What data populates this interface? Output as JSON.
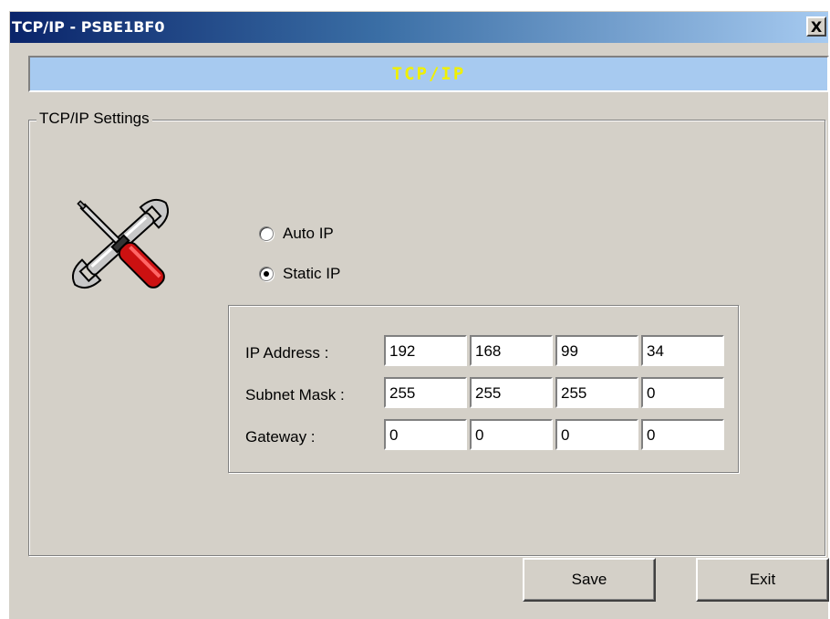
{
  "window": {
    "title": "TCP/IP - PSBE1BF0",
    "close_label": "X"
  },
  "banner": {
    "title": "TCP/IP"
  },
  "group": {
    "legend": "TCP/IP Settings"
  },
  "mode": {
    "options": [
      {
        "label": "Auto IP",
        "checked": false
      },
      {
        "label": "Static IP",
        "checked": true
      }
    ]
  },
  "network": {
    "rows": [
      {
        "label": "IP Address :",
        "octets": [
          "192",
          "168",
          "99",
          "34"
        ]
      },
      {
        "label": "Subnet Mask :",
        "octets": [
          "255",
          "255",
          "255",
          "0"
        ]
      },
      {
        "label": "Gateway :",
        "octets": [
          "0",
          "0",
          "0",
          "0"
        ]
      }
    ]
  },
  "buttons": {
    "save": "Save",
    "exit": "Exit"
  },
  "colors": {
    "titlebar_start": "#0a246a",
    "banner_bg": "#a7caf0",
    "banner_text": "#f0f000",
    "dialog_bg": "#d4d0c8"
  },
  "icons": {
    "settings": "tools-icon"
  }
}
